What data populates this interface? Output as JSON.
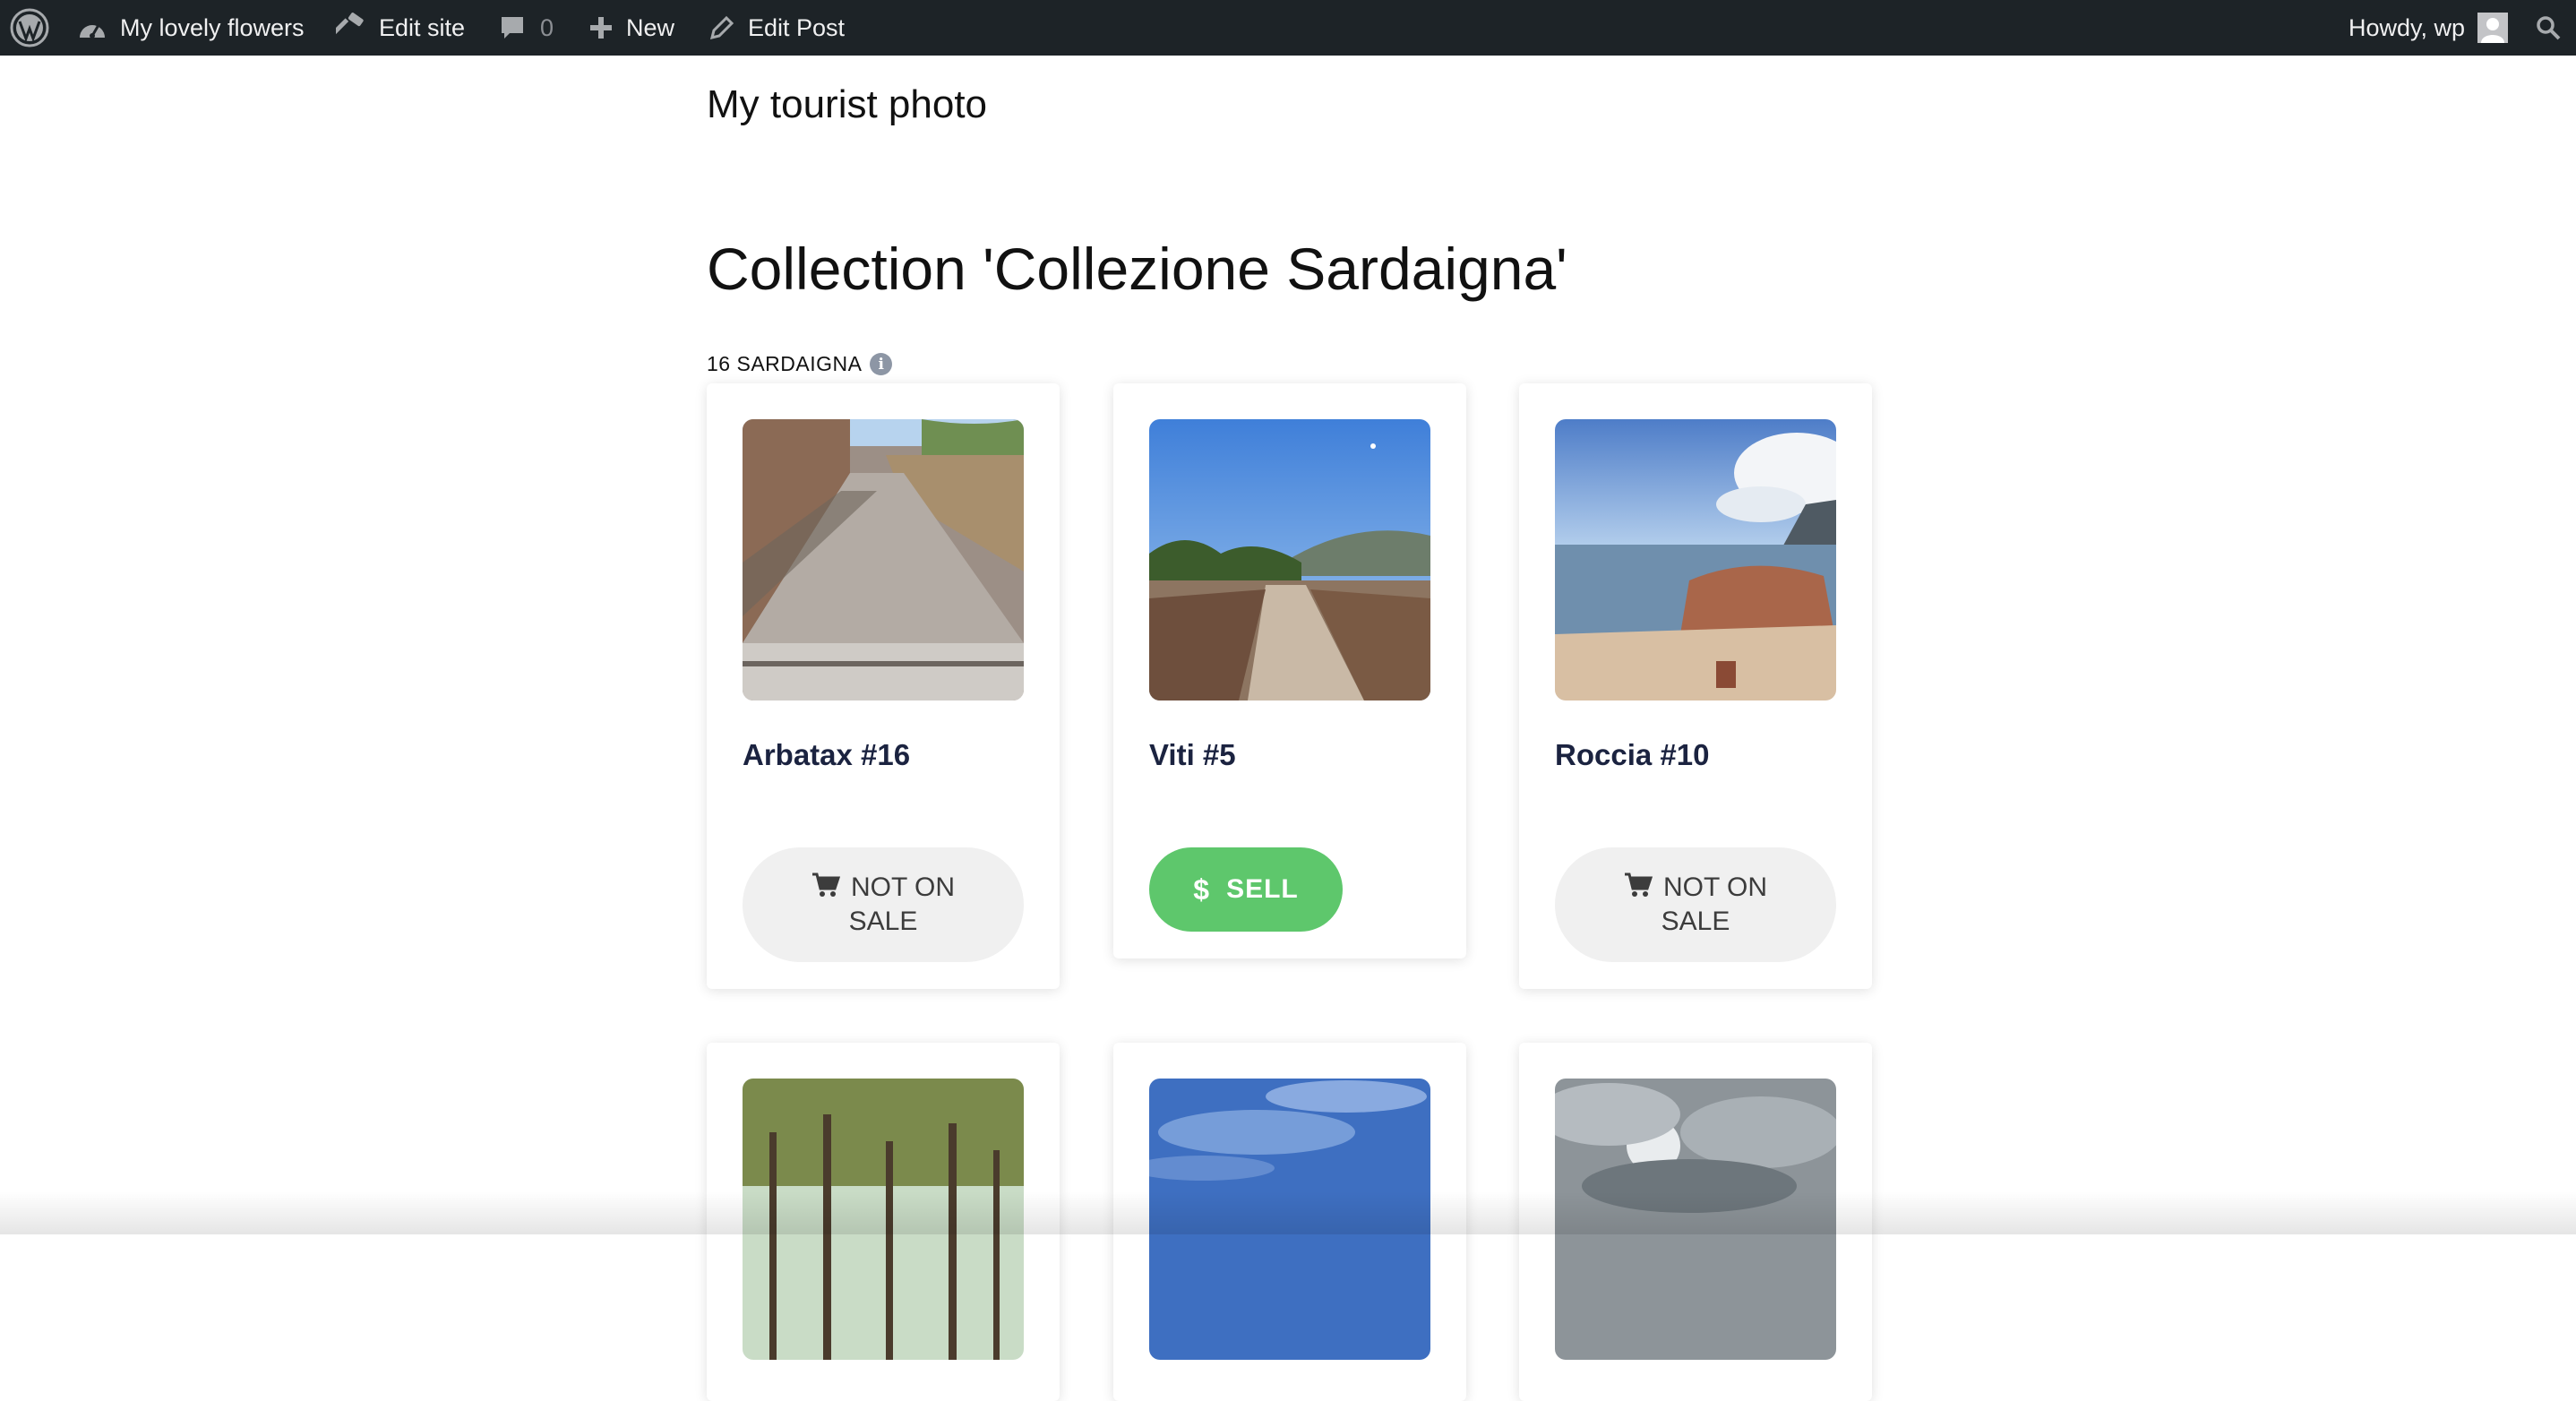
{
  "admin_bar": {
    "wp_logo": "wordpress-icon",
    "site_name": "My lovely flowers",
    "edit_site": "Edit site",
    "comments_count": "0",
    "new_label": "New",
    "edit_post": "Edit Post",
    "greeting": "Howdy, wp",
    "bg_color": "#1d2327"
  },
  "site": {
    "title": "My tourist photo"
  },
  "collection": {
    "title": "Collection 'Collezione Sardaigna'",
    "meta": "16 SARDAIGNA",
    "items": [
      {
        "name": "Arbatax #16",
        "button": "NOT ON SALE",
        "status": "not_on_sale",
        "image": "stone-path-photo"
      },
      {
        "name": "Viti #5",
        "button": "SELL",
        "status": "sell",
        "image": "vineyard-photo"
      },
      {
        "name": "Roccia #10",
        "button": "NOT ON SALE",
        "status": "not_on_sale",
        "image": "rocky-beach-photo"
      },
      {
        "image": "pine-trees-photo"
      },
      {
        "image": "blue-sky-clouds-photo"
      },
      {
        "image": "cloudy-sky-photo"
      }
    ]
  },
  "colors": {
    "sell_button": "#5ec76c",
    "not_on_sale_button": "#f0f0f0",
    "card_title": "#1b2340"
  }
}
